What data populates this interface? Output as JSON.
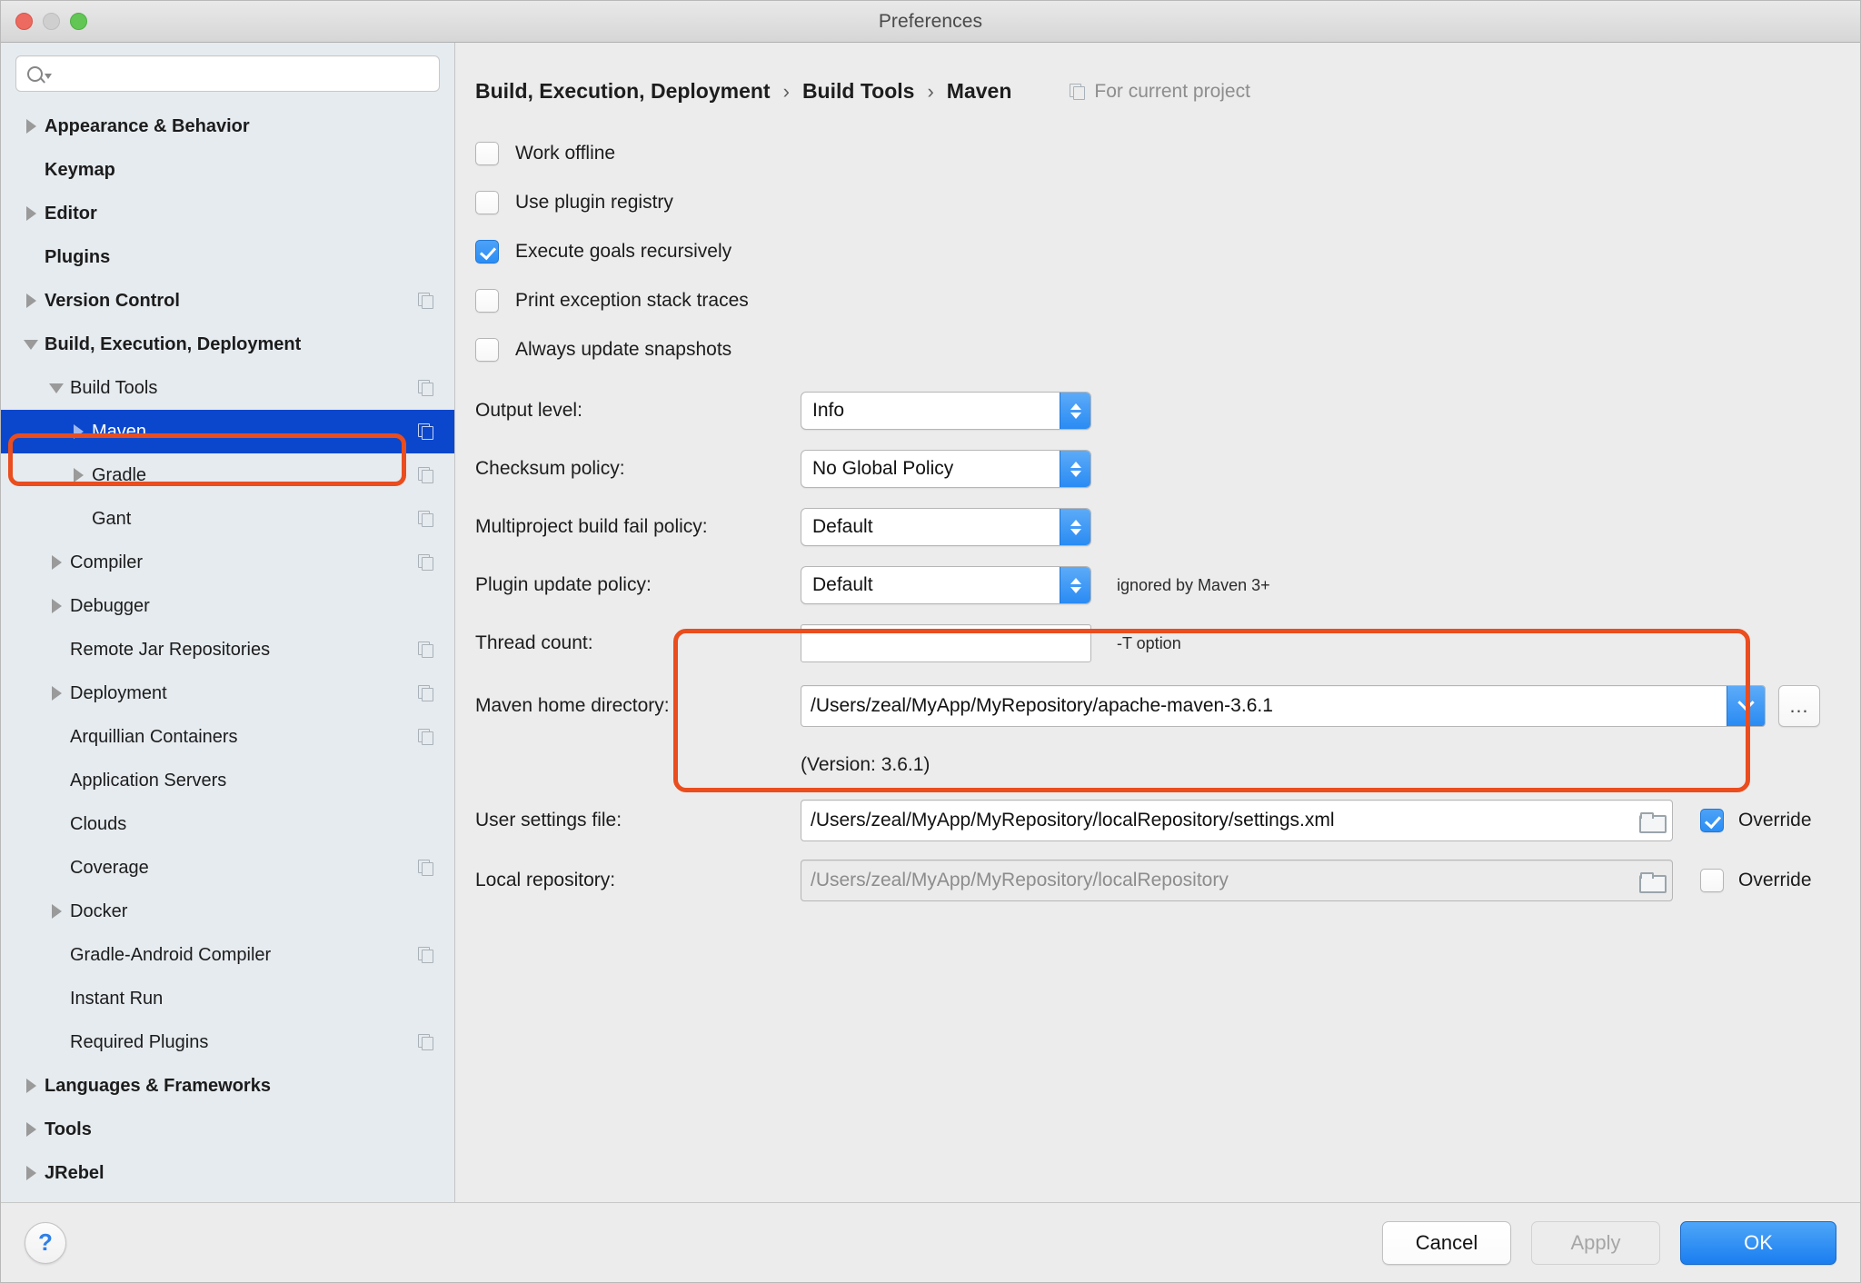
{
  "window": {
    "title": "Preferences",
    "traffic_lights": [
      "close",
      "minimize",
      "zoom"
    ]
  },
  "sidebar": {
    "search": {
      "value": "",
      "placeholder": ""
    },
    "items": [
      {
        "label": "Appearance & Behavior",
        "level": 0,
        "arrow": "right",
        "dup": false,
        "selected": false
      },
      {
        "label": "Keymap",
        "level": 0,
        "arrow": "none",
        "dup": false,
        "selected": false
      },
      {
        "label": "Editor",
        "level": 0,
        "arrow": "right",
        "dup": false,
        "selected": false
      },
      {
        "label": "Plugins",
        "level": 0,
        "arrow": "none",
        "dup": false,
        "selected": false
      },
      {
        "label": "Version Control",
        "level": 0,
        "arrow": "right",
        "dup": true,
        "selected": false
      },
      {
        "label": "Build, Execution, Deployment",
        "level": 0,
        "arrow": "down",
        "dup": false,
        "selected": false
      },
      {
        "label": "Build Tools",
        "level": 1,
        "arrow": "down",
        "dup": true,
        "selected": false
      },
      {
        "label": "Maven",
        "level": 2,
        "arrow": "right",
        "dup": true,
        "selected": true
      },
      {
        "label": "Gradle",
        "level": 2,
        "arrow": "right",
        "dup": true,
        "selected": false
      },
      {
        "label": "Gant",
        "level": 2,
        "arrow": "none",
        "dup": true,
        "selected": false
      },
      {
        "label": "Compiler",
        "level": 1,
        "arrow": "right",
        "dup": true,
        "selected": false
      },
      {
        "label": "Debugger",
        "level": 1,
        "arrow": "right",
        "dup": false,
        "selected": false
      },
      {
        "label": "Remote Jar Repositories",
        "level": 1,
        "arrow": "none",
        "dup": true,
        "selected": false
      },
      {
        "label": "Deployment",
        "level": 1,
        "arrow": "right",
        "dup": true,
        "selected": false
      },
      {
        "label": "Arquillian Containers",
        "level": 1,
        "arrow": "none",
        "dup": true,
        "selected": false
      },
      {
        "label": "Application Servers",
        "level": 1,
        "arrow": "none",
        "dup": false,
        "selected": false
      },
      {
        "label": "Clouds",
        "level": 1,
        "arrow": "none",
        "dup": false,
        "selected": false
      },
      {
        "label": "Coverage",
        "level": 1,
        "arrow": "none",
        "dup": true,
        "selected": false
      },
      {
        "label": "Docker",
        "level": 1,
        "arrow": "right",
        "dup": false,
        "selected": false
      },
      {
        "label": "Gradle-Android Compiler",
        "level": 1,
        "arrow": "none",
        "dup": true,
        "selected": false
      },
      {
        "label": "Instant Run",
        "level": 1,
        "arrow": "none",
        "dup": false,
        "selected": false
      },
      {
        "label": "Required Plugins",
        "level": 1,
        "arrow": "none",
        "dup": true,
        "selected": false
      },
      {
        "label": "Languages & Frameworks",
        "level": 0,
        "arrow": "right",
        "dup": false,
        "selected": false
      },
      {
        "label": "Tools",
        "level": 0,
        "arrow": "right",
        "dup": false,
        "selected": false
      },
      {
        "label": "JRebel",
        "level": 0,
        "arrow": "right",
        "dup": false,
        "selected": false
      }
    ]
  },
  "main": {
    "breadcrumb": {
      "crumb1": "Build, Execution, Deployment",
      "crumb2": "Build Tools",
      "crumb3": "Maven",
      "separator": "›",
      "scope_label": "For current project"
    },
    "checkboxes": [
      {
        "label": "Work offline",
        "checked": false
      },
      {
        "label": "Use plugin registry",
        "checked": false
      },
      {
        "label": "Execute goals recursively",
        "checked": true
      },
      {
        "label": "Print exception stack traces",
        "checked": false
      },
      {
        "label": "Always update snapshots",
        "checked": false
      }
    ],
    "fields": {
      "output_level": {
        "label": "Output level:",
        "value": "Info"
      },
      "checksum_policy": {
        "label": "Checksum policy:",
        "value": "No Global Policy"
      },
      "multiproject_fail_policy": {
        "label": "Multiproject build fail policy:",
        "value": "Default"
      },
      "plugin_update_policy": {
        "label": "Plugin update policy:",
        "value": "Default",
        "hint": "ignored by Maven 3+"
      },
      "thread_count": {
        "label": "Thread count:",
        "value": "",
        "hint": "-T option"
      },
      "maven_home": {
        "label": "Maven home directory:",
        "value": "/Users/zeal/MyApp/MyRepository/apache-maven-3.6.1",
        "browse_label": "…"
      },
      "maven_version": {
        "text": "(Version: 3.6.1)"
      },
      "user_settings": {
        "label": "User settings file:",
        "value": "/Users/zeal/MyApp/MyRepository/localRepository/settings.xml",
        "override_label": "Override",
        "override_checked": true
      },
      "local_repository": {
        "label": "Local repository:",
        "value": "/Users/zeal/MyApp/MyRepository/localRepository",
        "override_label": "Override",
        "override_checked": false,
        "disabled": true
      }
    }
  },
  "footer": {
    "help_label": "?",
    "cancel_label": "Cancel",
    "apply_label": "Apply",
    "ok_label": "OK"
  },
  "annotations": {
    "accent_color": "#ea4d1e",
    "selection_color": "#0b47cc"
  }
}
